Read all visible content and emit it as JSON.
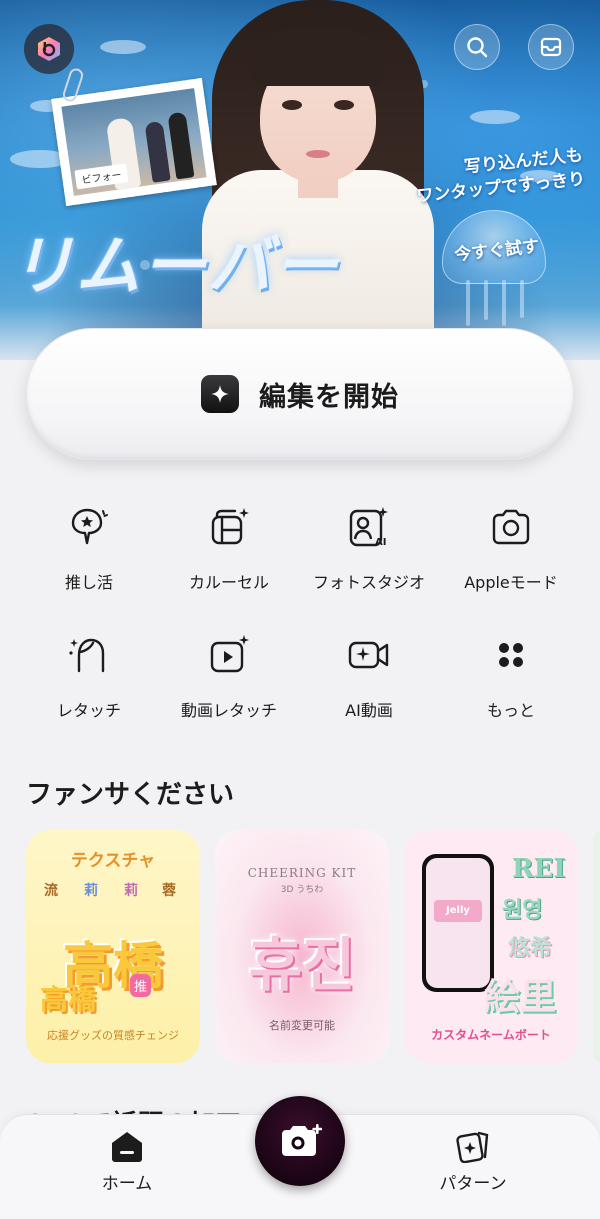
{
  "hero": {
    "logo_text": "リムーバー",
    "tagline_line1": "写り込んだ人も",
    "tagline_line2": "ワンタップですっきり",
    "jelly_text": "今すぐ試す",
    "before_label": "ビフォー"
  },
  "start_button": {
    "label": "編集を開始"
  },
  "features": [
    {
      "label": "推し活",
      "icon": "fan-icon"
    },
    {
      "label": "カルーセル",
      "icon": "carousel-icon"
    },
    {
      "label": "フォトスタジオ",
      "icon": "ai-portrait-icon"
    },
    {
      "label": "Appleモード",
      "icon": "camera-icon"
    },
    {
      "label": "レタッチ",
      "icon": "face-retouch-icon"
    },
    {
      "label": "動画レタッチ",
      "icon": "video-sparkle-icon"
    },
    {
      "label": "AI動画",
      "icon": "video-camera-sparkle-icon"
    },
    {
      "label": "もっと",
      "icon": "grid-dots-icon"
    }
  ],
  "section": {
    "title": "ファンサください",
    "cards": [
      {
        "title": "テクスチャ",
        "main": "高橋",
        "sub": "高橋",
        "tag": "推",
        "footer": "応援グッズの質感チェンジ"
      },
      {
        "title": "CHEERING KIT",
        "subtitle": "3D うちわ",
        "main": "휴진",
        "footer": "名前変更可能"
      },
      {
        "phone_text": "Jelly",
        "tags": [
          "REI",
          "원영",
          "悠希",
          "絵里"
        ],
        "footer": "カスタムネームボート"
      }
    ]
  },
  "next_section": {
    "title": "SNSで話題の加工"
  },
  "bottom_nav": {
    "home_label": "ホーム",
    "pattern_label": "パターン"
  },
  "colors": {
    "accent_dark": "#1c1c1c",
    "fab": "#1a0414",
    "card1_bg": "#fdf0a8",
    "card2_bg": "#fbe7ef",
    "card3_bg": "#fdeaf2"
  }
}
